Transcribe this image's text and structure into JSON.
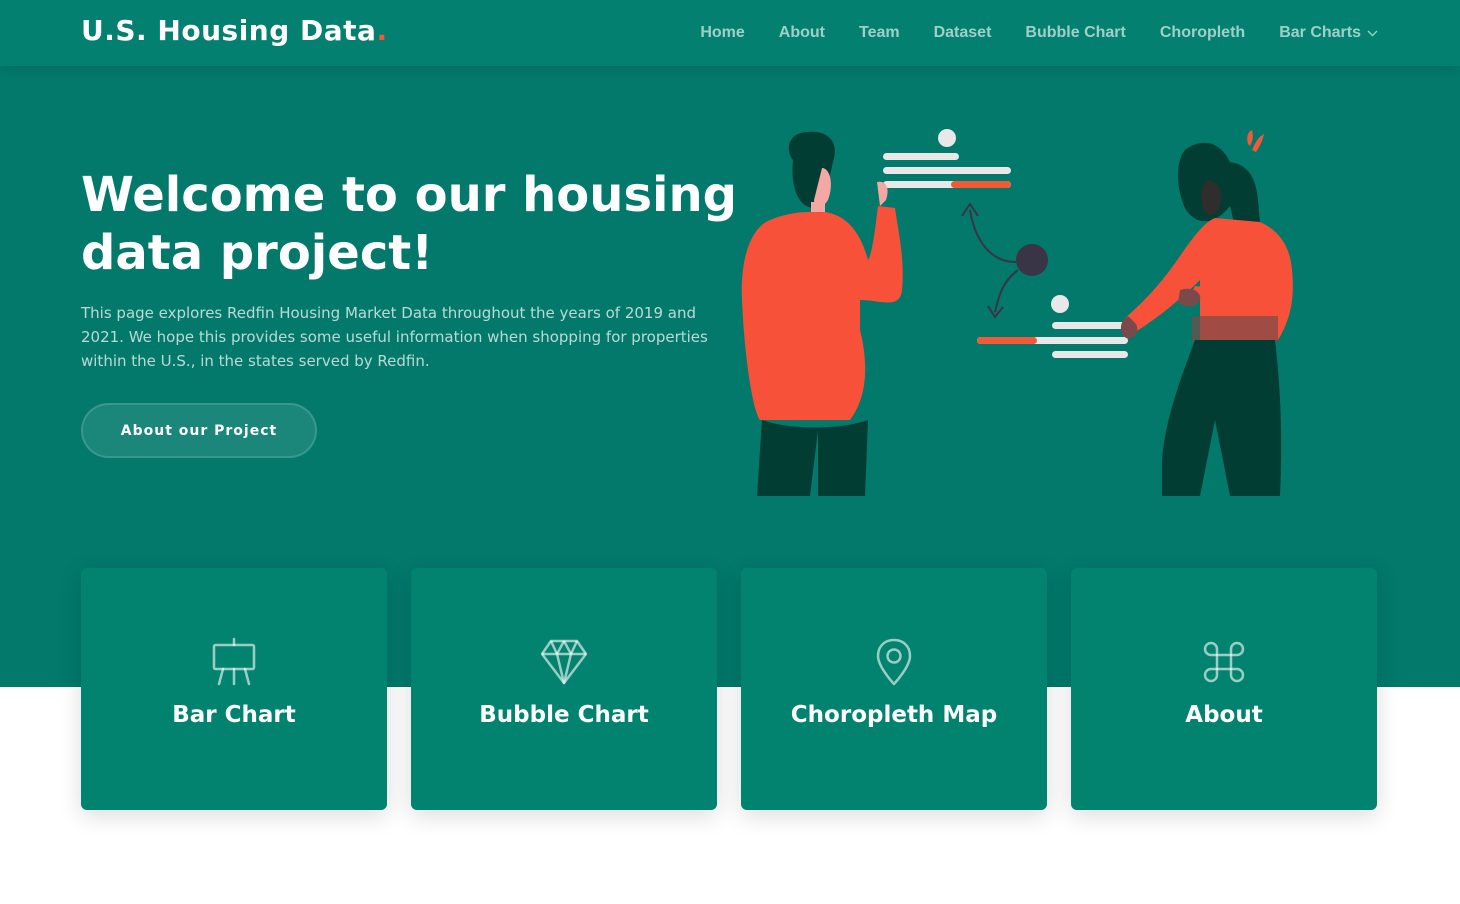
{
  "header": {
    "logo_text": "U.S. Housing Data",
    "logo_dot": ".",
    "nav": [
      {
        "label": "Home"
      },
      {
        "label": "About"
      },
      {
        "label": "Team"
      },
      {
        "label": "Dataset"
      },
      {
        "label": "Bubble Chart"
      },
      {
        "label": "Choropleth"
      },
      {
        "label": "Bar Charts",
        "has_dropdown": true
      }
    ]
  },
  "hero": {
    "title": "Welcome to our housing data project!",
    "description": "This page explores Redfin Housing Market Data throughout the years of 2019 and 2021. We hope this provides some useful information when shopping for properties within the U.S., in the states served by Redfin.",
    "button_label": "About our Project",
    "illustration_icon": "two-people-presenting-data-illustration"
  },
  "cards": [
    {
      "title": "Bar Chart",
      "icon": "easel-chart-icon"
    },
    {
      "title": "Bubble Chart",
      "icon": "diamond-icon"
    },
    {
      "title": "Choropleth Map",
      "icon": "map-pin-icon"
    },
    {
      "title": "About",
      "icon": "command-key-icon"
    }
  ],
  "colors": {
    "primary": "#02796b",
    "header": "#03806f",
    "card": "#02836f",
    "accent": "#f15a36",
    "dark_green": "#023d33"
  }
}
